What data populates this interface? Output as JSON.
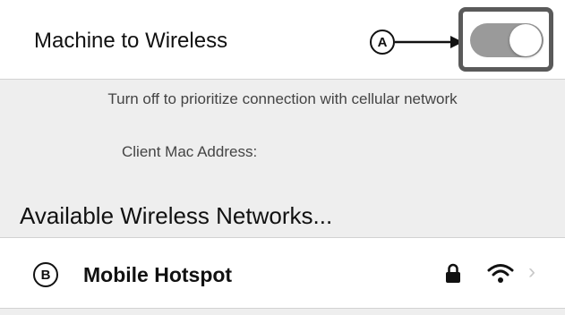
{
  "wireless_toggle": {
    "label": "Machine to Wireless",
    "callout": "A",
    "state": "on",
    "track_color": "#9a9a9a"
  },
  "helper_text": "Turn off to prioritize connection with cellular network",
  "mac_address_label": "Client Mac Address:",
  "section_header": "Available Wireless Networks...",
  "networks": [
    {
      "callout": "B",
      "name": "Mobile Hotspot",
      "icons": [
        "lock-icon",
        "wifi-icon",
        "chevron-right-icon"
      ]
    }
  ]
}
